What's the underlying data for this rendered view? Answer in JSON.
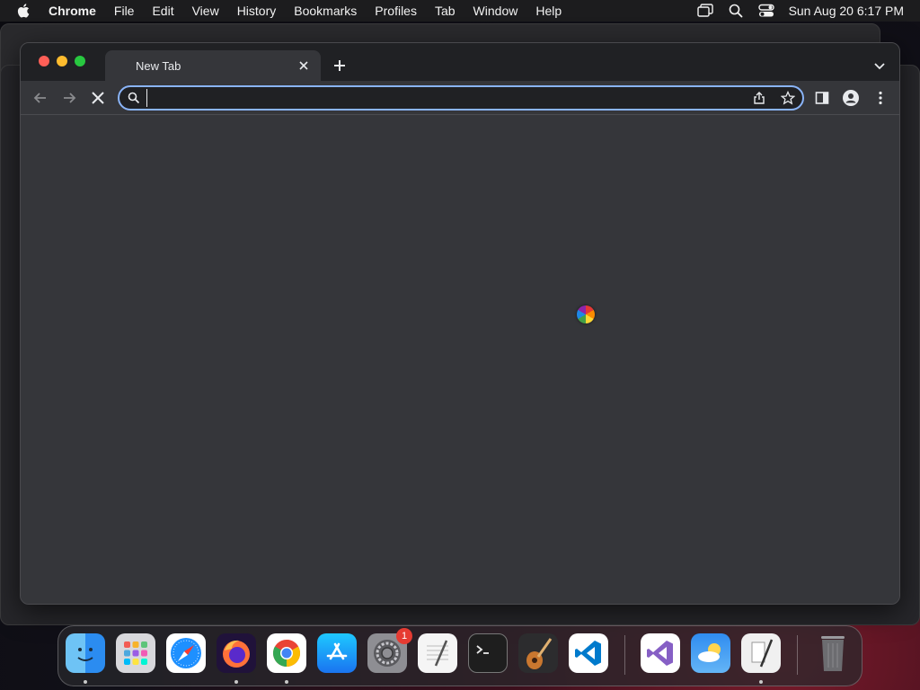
{
  "menubar": {
    "app_name": "Chrome",
    "items": [
      "File",
      "Edit",
      "View",
      "History",
      "Bookmarks",
      "Profiles",
      "Tab",
      "Window",
      "Help"
    ],
    "clock": "Sun Aug 20  6:17 PM"
  },
  "browser": {
    "tab_title": "New Tab",
    "address_value": "",
    "address_focus_color": "#8ab4f8",
    "page_state": "loading"
  },
  "dock": {
    "apps": [
      {
        "name": "Finder",
        "running": true
      },
      {
        "name": "Launchpad",
        "running": false
      },
      {
        "name": "Safari",
        "running": false
      },
      {
        "name": "Firefox",
        "running": true
      },
      {
        "name": "Google Chrome",
        "running": true
      },
      {
        "name": "App Store",
        "running": false
      },
      {
        "name": "System Settings",
        "running": false,
        "badge": "1"
      },
      {
        "name": "TextEdit",
        "running": false
      },
      {
        "name": "Terminal",
        "running": false
      },
      {
        "name": "GarageBand",
        "running": false
      },
      {
        "name": "Visual Studio Code",
        "running": false
      },
      {
        "name": "Visual Studio",
        "running": false
      },
      {
        "name": "Weather",
        "running": false
      },
      {
        "name": "Script Editor",
        "running": true
      },
      {
        "name": "Trash",
        "running": false
      }
    ]
  }
}
